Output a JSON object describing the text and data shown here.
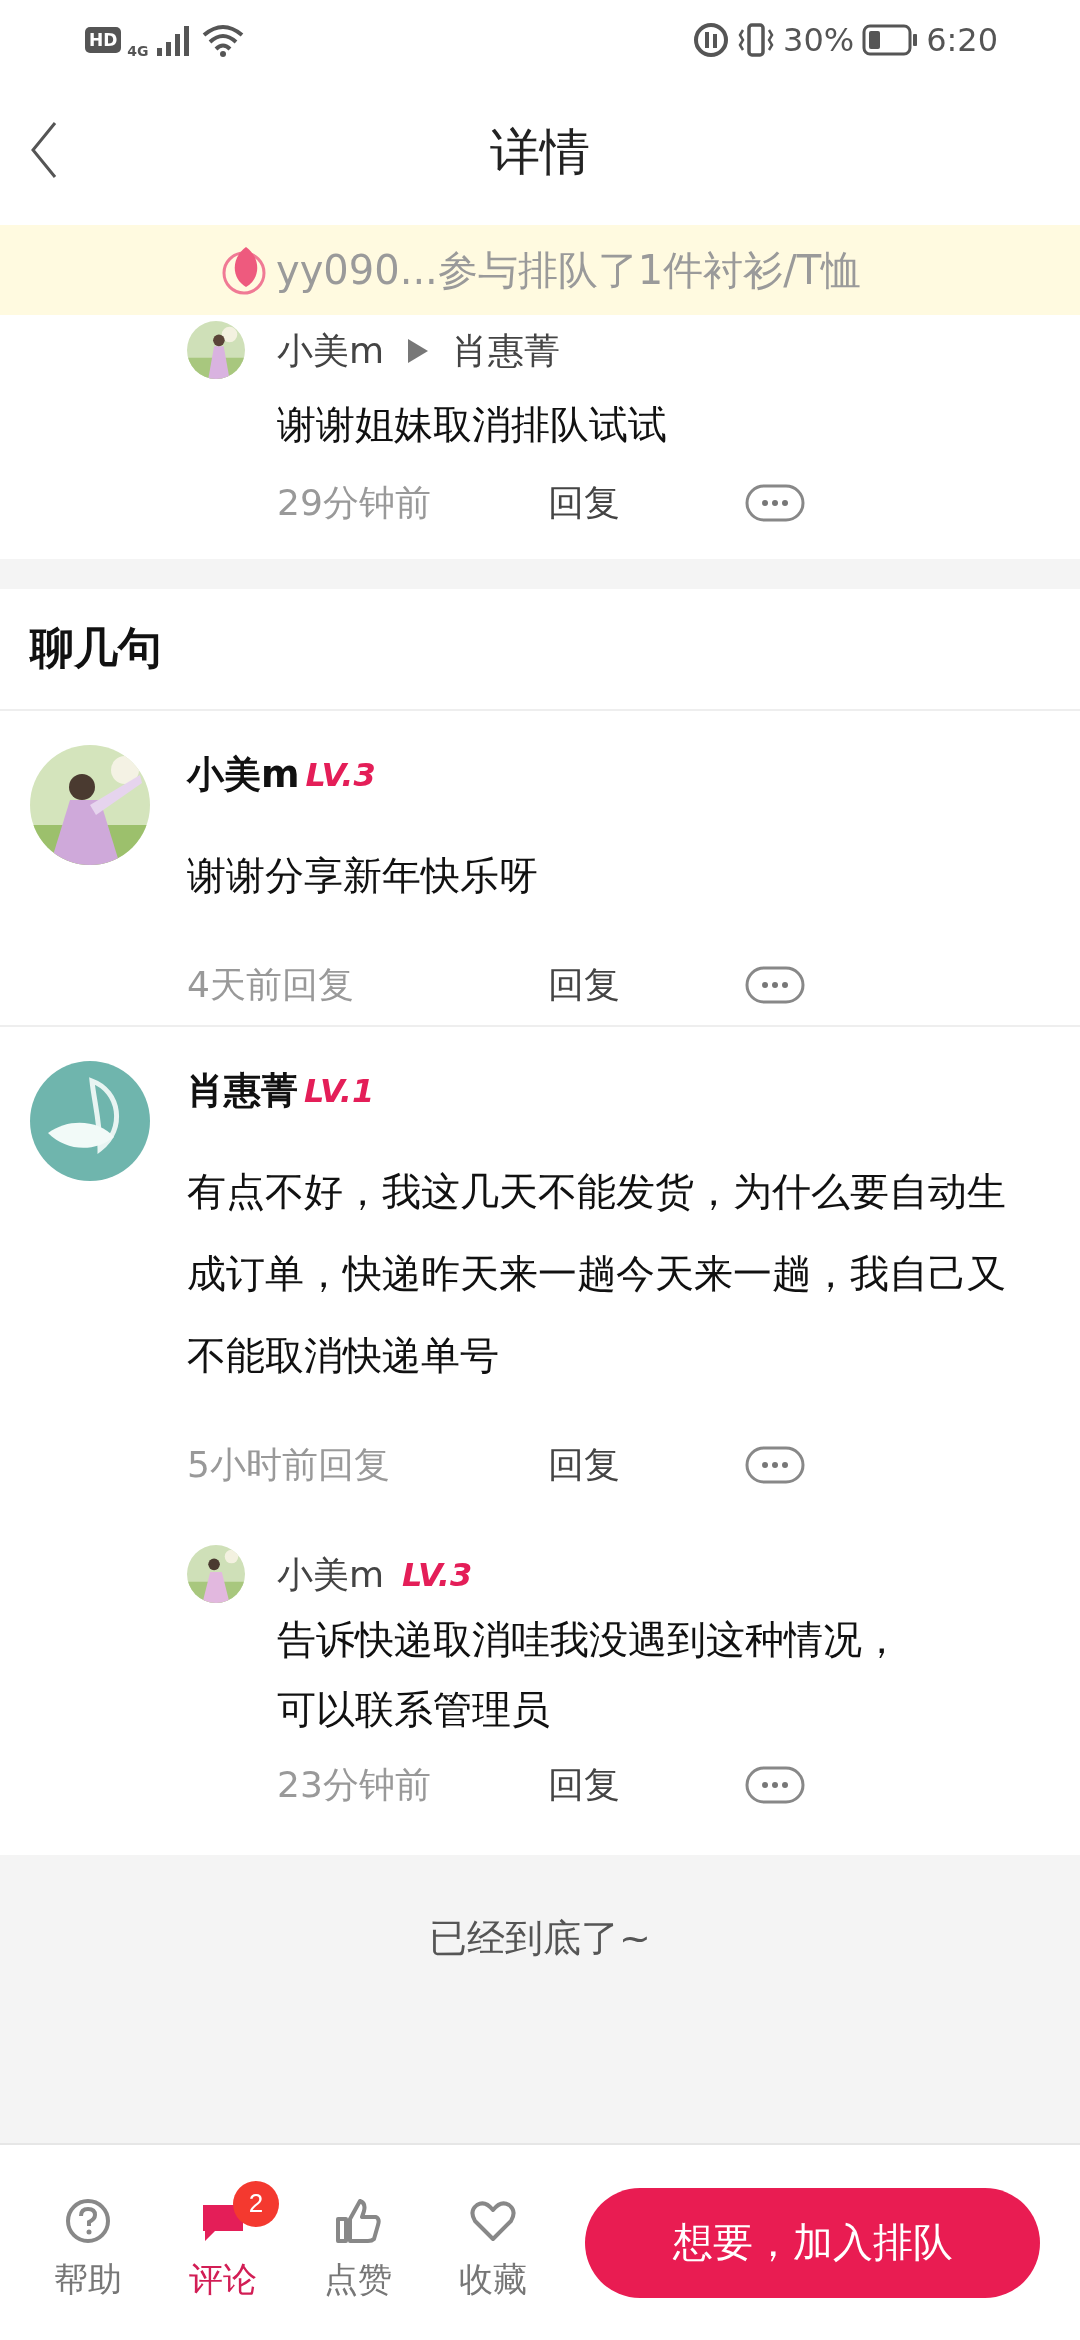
{
  "status_bar": {
    "hd": "HD",
    "network": "4G",
    "battery": "30%",
    "time": "6:20"
  },
  "header": {
    "title": "详情"
  },
  "banner": {
    "text": "yy090...参与排队了1件衬衫/T恤"
  },
  "top_reply": {
    "author": "小美m",
    "reply_to": "肖惠菁",
    "text": "谢谢姐妹取消排队试试",
    "time": "29分钟前",
    "reply_label": "回复"
  },
  "section_title": "聊几句",
  "comments": [
    {
      "author": "小美m",
      "level": "LV.3",
      "kind": "picture",
      "text": "谢谢分享新年快乐呀",
      "time": "4天前回复",
      "reply_label": "回复"
    },
    {
      "author": "肖惠菁",
      "level": "LV.1",
      "kind": "leaf",
      "text": "有点不好，我这几天不能发货，为什么要自动生成订单，快递昨天来一趟今天来一趟，我自己又不能取消快递单号",
      "time": "5小时前回复",
      "reply_label": "回复",
      "replies": [
        {
          "author": "小美m",
          "level": "LV.3",
          "text": "告诉快递取消哇我没遇到这种情况，可以联系管理员",
          "time": "23分钟前",
          "reply_label": "回复"
        }
      ]
    }
  ],
  "end_note": "已经到底了~",
  "bottom_bar": {
    "items": [
      {
        "kind": "help",
        "label": "帮助",
        "selected": false
      },
      {
        "kind": "comment",
        "label": "评论",
        "selected": true,
        "badge": "2"
      },
      {
        "kind": "like",
        "label": "点赞",
        "selected": false
      },
      {
        "kind": "favorite",
        "label": "收藏",
        "selected": false
      }
    ],
    "cta": "想要，加入排队"
  }
}
